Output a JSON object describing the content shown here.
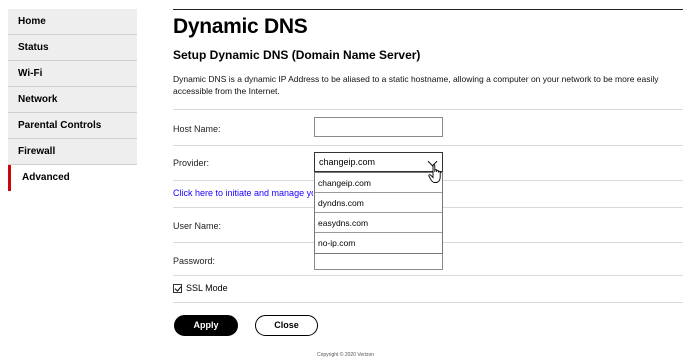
{
  "sidebar": {
    "items": [
      {
        "label": "Home"
      },
      {
        "label": "Status"
      },
      {
        "label": "Wi-Fi"
      },
      {
        "label": "Network"
      },
      {
        "label": "Parental Controls"
      },
      {
        "label": "Firewall"
      },
      {
        "label": "Advanced"
      }
    ],
    "active_index": 6
  },
  "page": {
    "title": "Dynamic DNS",
    "subtitle": "Setup Dynamic DNS (Domain Name Server)",
    "description": "Dynamic DNS is a dynamic IP Address to be aliased to a static hostname, allowing a computer on your network to be more easily accessible from the Internet."
  },
  "form": {
    "host_name": {
      "label": "Host Name:",
      "value": ""
    },
    "provider": {
      "label": "Provider:",
      "selected": "changeip.com",
      "options": [
        "changeip.com",
        "dyndns.com",
        "easydns.com",
        "no-ip.com"
      ]
    },
    "manage_link": "Click here to initiate and manage your subscription",
    "user_name": {
      "label": "User Name:",
      "value": ""
    },
    "password": {
      "label": "Password:",
      "value": ""
    },
    "ssl_mode": {
      "label": "SSL Mode",
      "checked": true
    }
  },
  "buttons": {
    "apply": "Apply",
    "close": "Close"
  },
  "footer": "Copyright © 2020 Verizon",
  "colors": {
    "accent": "#cd040b",
    "link": "#1a00ff"
  }
}
